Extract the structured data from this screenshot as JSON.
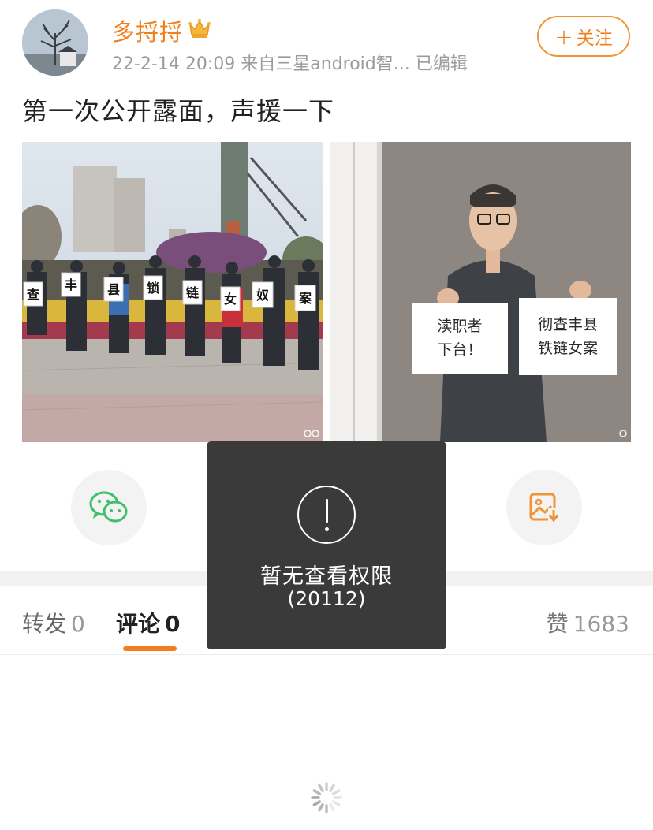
{
  "post": {
    "username": "多捋捋",
    "meta": "22-2-14 20:09  来自三星android智...  已编辑",
    "follow_label": "关注",
    "text": "第一次公开露面，声援一下"
  },
  "photos": {
    "left_signs": [
      "查",
      "丰",
      "县",
      "锁",
      "链",
      "女",
      "奴",
      "案"
    ],
    "right_sign_left": [
      "渎职者",
      "下台！"
    ],
    "right_sign_right": [
      "彻查丰县",
      "铁链女案"
    ]
  },
  "share": {
    "icons": [
      "wechat-icon",
      "moments-icon",
      "qq-icon",
      "save-image-icon"
    ]
  },
  "tabs": {
    "repost_label": "转发",
    "repost_count": "0",
    "comment_label": "评论",
    "comment_count": "0",
    "like_label": "赞",
    "like_count": "1683"
  },
  "toast": {
    "message": "暂无查看权限",
    "code": "(20112)"
  },
  "colors": {
    "accent": "#f27f1c",
    "wechat_green": "#3fbf6a",
    "toast_bg": "#3a3a3a"
  }
}
